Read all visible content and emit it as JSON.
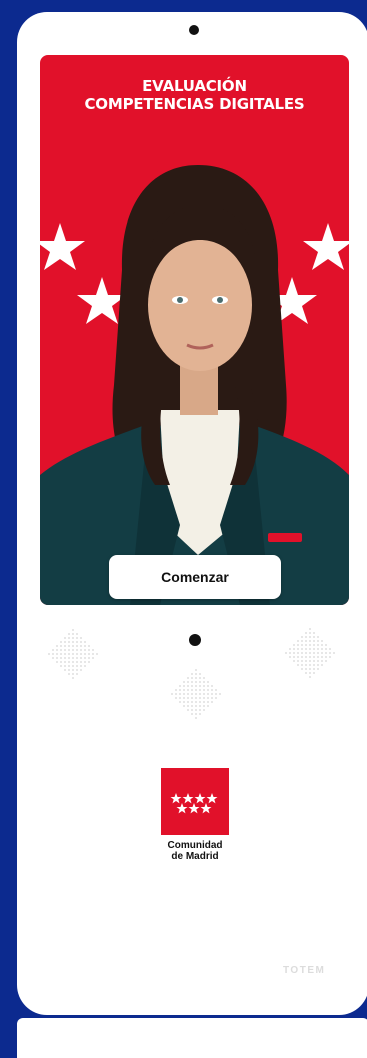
{
  "screen": {
    "title_line1": "EVALUACIÓN",
    "title_line2": "COMPETENCIAS DIGITALES",
    "button_label": "Comenzar",
    "background_color": "#e1112a"
  },
  "logo": {
    "line1": "Comunidad",
    "line2": "de Madrid",
    "color": "#e1112a"
  },
  "device": {
    "brand": "TOTEM",
    "frame_color": "#0c2a8f"
  }
}
